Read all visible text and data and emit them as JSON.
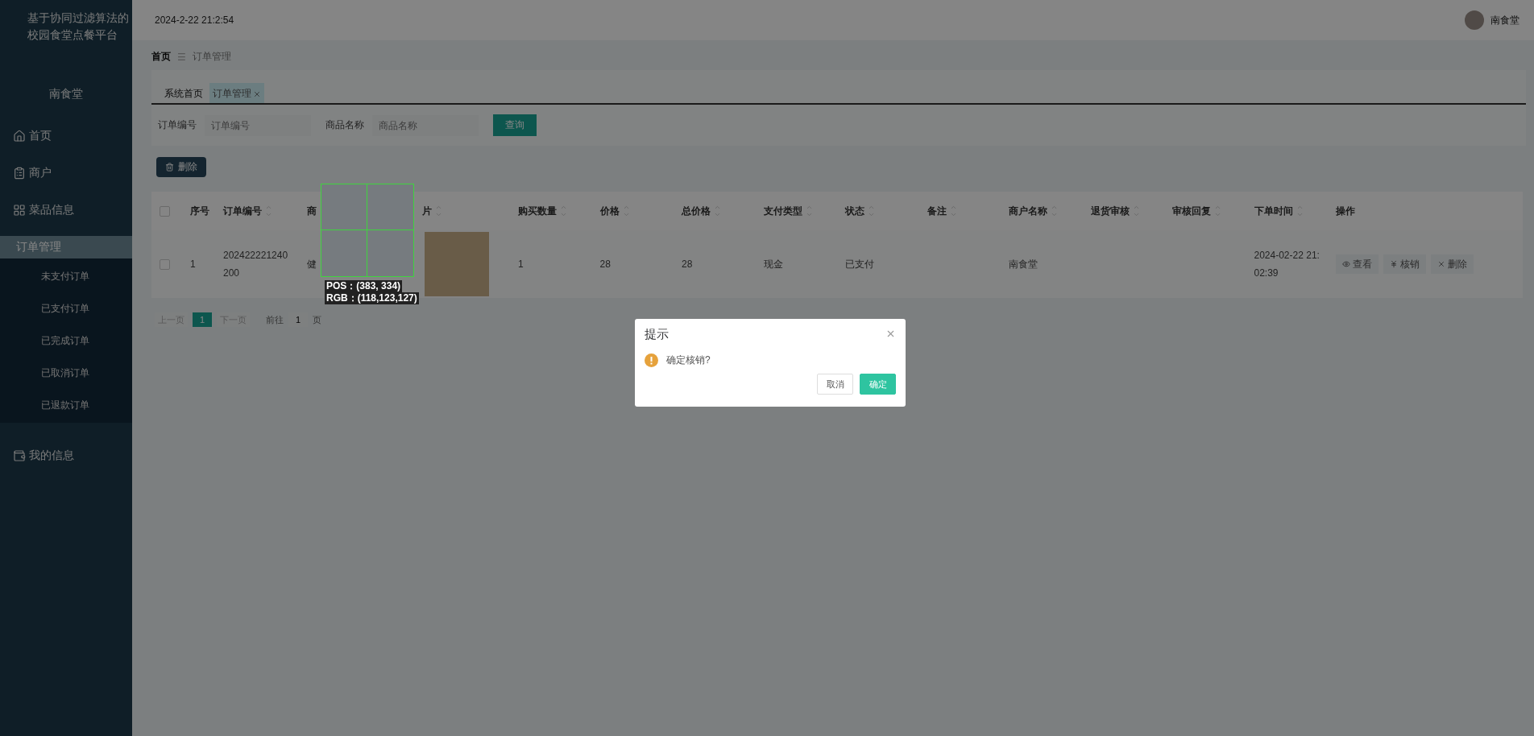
{
  "sidebar": {
    "title": "基于协同过滤算法的校园食堂点餐平台",
    "shop_name": "南食堂",
    "menu": [
      {
        "label": "首页",
        "selected": false
      },
      {
        "label": "商户",
        "selected": false
      },
      {
        "label": "菜品信息",
        "selected": false
      },
      {
        "label": "订单管理",
        "selected": true,
        "expanded": true,
        "children": [
          {
            "label": "未支付订单",
            "selected": false
          },
          {
            "label": "已支付订单",
            "selected": false
          },
          {
            "label": "已完成订单",
            "selected": false
          },
          {
            "label": "已取消订单",
            "selected": false
          },
          {
            "label": "已退款订单",
            "selected": false
          }
        ]
      },
      {
        "label": "我的信息",
        "selected": false
      }
    ]
  },
  "header": {
    "datetime": "2024-2-22 21:2:54",
    "user": "南食堂"
  },
  "breadcrumb": [
    "首页",
    "订单管理"
  ],
  "breadcrumb_separator": "☰",
  "tabs": [
    {
      "label": "系统首页",
      "selected": false,
      "closable": false
    },
    {
      "label": "订单管理",
      "selected": true,
      "closable": true
    }
  ],
  "search": {
    "fields": [
      {
        "label": "订单编号",
        "placeholder": "订单编号"
      },
      {
        "label": "商品名称",
        "placeholder": "商品名称"
      }
    ],
    "button": "查询"
  },
  "delete_button": "删除",
  "table": {
    "columns": [
      {
        "kind": "checkbox",
        "checked": false,
        "sortable": false
      },
      {
        "label": "序号",
        "kind": "text",
        "sortable": false
      },
      {
        "label": "订单编号",
        "kind": "text",
        "sortable": true
      },
      {
        "label": "商",
        "kind": "text",
        "sortable": false
      },
      {
        "label": "片",
        "kind": "text",
        "sortable": true
      },
      {
        "label": "购买数量",
        "kind": "text",
        "sortable": true
      },
      {
        "label": "价格",
        "kind": "text",
        "sortable": true
      },
      {
        "label": "总价格",
        "kind": "text",
        "sortable": true
      },
      {
        "label": "支付类型",
        "kind": "text",
        "sortable": true
      },
      {
        "label": "状态",
        "kind": "text",
        "sortable": true
      },
      {
        "label": "备注",
        "kind": "text",
        "sortable": true
      },
      {
        "label": "商户名称",
        "kind": "text",
        "sortable": true
      },
      {
        "label": "退货审核",
        "kind": "text",
        "sortable": true
      },
      {
        "label": "审核回复",
        "kind": "text",
        "sortable": true
      },
      {
        "label": "下单时间",
        "kind": "text",
        "sortable": true
      },
      {
        "label": "操作",
        "kind": "text",
        "sortable": false
      }
    ],
    "rows": [
      {
        "cells": [
          {
            "kind": "checkbox",
            "checked": false
          },
          {
            "kind": "text",
            "text": "1"
          },
          {
            "kind": "text",
            "text": "202422221240200"
          },
          {
            "kind": "text",
            "text": "健"
          },
          {
            "kind": "image"
          },
          {
            "kind": "text",
            "text": "1"
          },
          {
            "kind": "text",
            "text": "28"
          },
          {
            "kind": "text",
            "text": "28"
          },
          {
            "kind": "text",
            "text": "现金"
          },
          {
            "kind": "text",
            "text": "已支付"
          },
          {
            "kind": "empty"
          },
          {
            "kind": "text",
            "text": "南食堂"
          },
          {
            "kind": "empty"
          },
          {
            "kind": "empty"
          },
          {
            "kind": "text",
            "text": "2024-02-22 21:02:39"
          },
          {
            "kind": "actions",
            "actions": [
              {
                "label": "查看"
              },
              {
                "label": "核销"
              },
              {
                "label": "删除"
              }
            ]
          }
        ]
      }
    ]
  },
  "pagination": {
    "prev": "上一页",
    "pages": [
      {
        "label": "1",
        "selected": true
      }
    ],
    "next": "下一页",
    "goto_label": "前往",
    "goto_value": "1",
    "goto_suffix": "页"
  },
  "picker": {
    "pos": "POS：(383, 334)",
    "rgb": "RGB：(118,123,127)"
  },
  "dialog": {
    "title": "提示",
    "message": "确定核销?",
    "buttons": [
      {
        "label": "取消",
        "primary": false
      },
      {
        "label": "确定",
        "primary": true
      }
    ]
  }
}
